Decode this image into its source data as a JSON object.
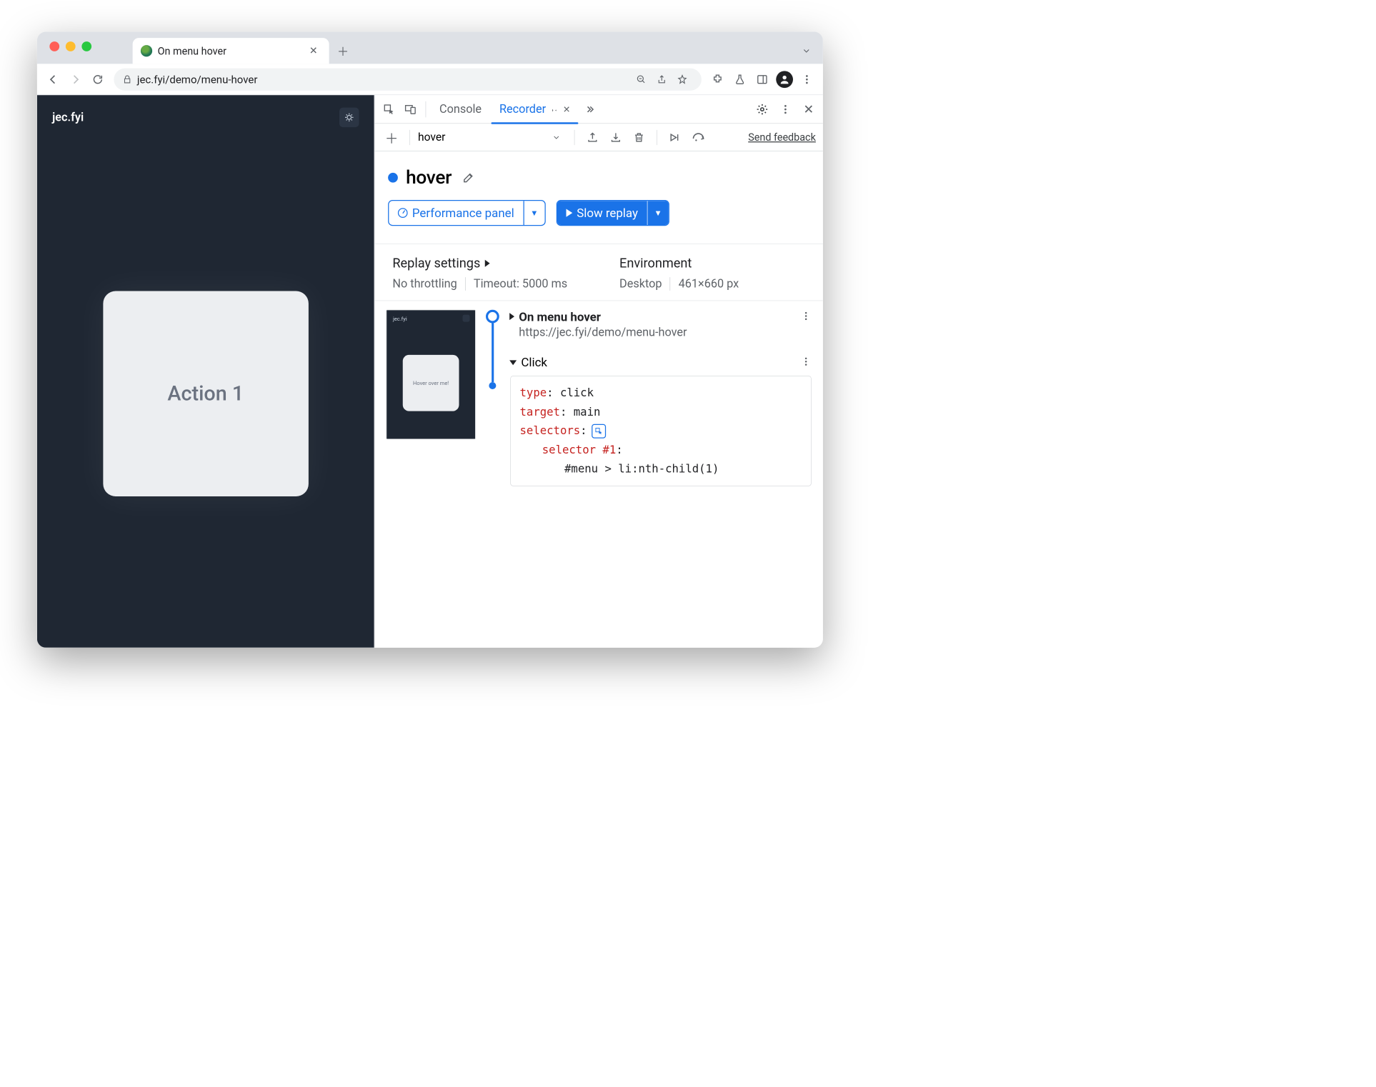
{
  "browser": {
    "tab_title": "On menu hover",
    "url": "jec.fyi/demo/menu-hover"
  },
  "page": {
    "site_title": "jec.fyi",
    "card_text": "Action 1"
  },
  "devtools": {
    "tab_console": "Console",
    "tab_recorder": "Recorder",
    "send_feedback": "Send feedback",
    "recording_name": "hover",
    "title": "hover",
    "btn_performance": "Performance panel",
    "btn_replay": "Slow replay",
    "settings": {
      "replay_title": "Replay settings",
      "throttling": "No throttling",
      "timeout": "Timeout: 5000 ms",
      "env_title": "Environment",
      "device": "Desktop",
      "dimensions": "461×660 px"
    },
    "thumb_card": "Hover over me!",
    "step1": {
      "title": "On menu hover",
      "url": "https://jec.fyi/demo/menu-hover"
    },
    "step2": {
      "title": "Click",
      "type_label": "type",
      "type_value": "click",
      "target_label": "target",
      "target_value": "main",
      "selectors_label": "selectors",
      "selector_label": "selector #1",
      "selector_value": "#menu > li:nth-child(1)"
    }
  }
}
